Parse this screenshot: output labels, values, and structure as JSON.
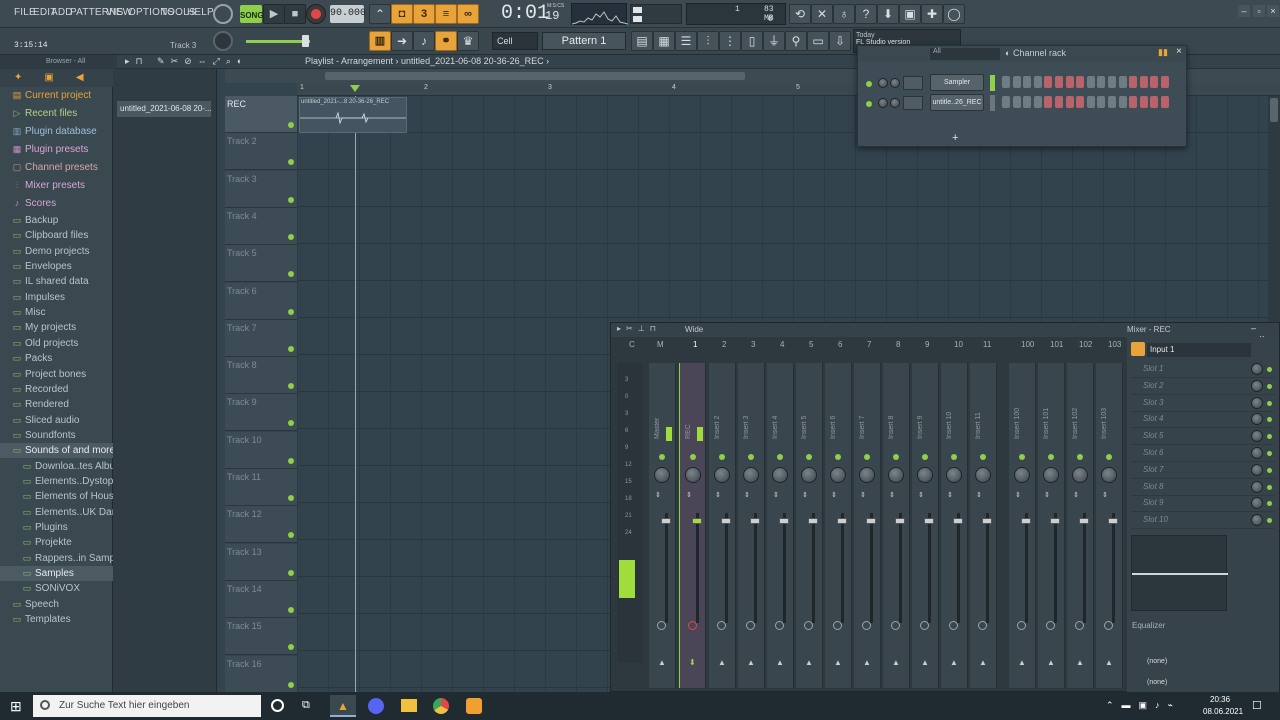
{
  "menu": [
    "FILE",
    "EDIT",
    "ADD",
    "PATTERNS",
    "VIEW",
    "OPTIONS",
    "TOOLS",
    "HELP"
  ],
  "transport": {
    "mode": "SONG",
    "tempo": "90.000",
    "time": "0:01",
    "time_ms": "19",
    "time_unit": "M:S:CS"
  },
  "hint": {
    "time": "3:15:14",
    "track": "Track 3"
  },
  "memory": {
    "value": "1",
    "mb": "83 MB",
    "voices": "0"
  },
  "snap": "Cell",
  "pattern": "Pattern 1",
  "news": {
    "line1": "Today",
    "line2": "FL Studio version"
  },
  "browser": {
    "title": "Browser - All",
    "items": [
      {
        "label": "Current project",
        "icon": "folder-project-icon"
      },
      {
        "label": "Recent files",
        "icon": "folder-recent-icon"
      },
      {
        "label": "Plugin database",
        "icon": "plugin-icon"
      },
      {
        "label": "Plugin presets",
        "icon": "plugin-preset-icon"
      },
      {
        "label": "Channel presets",
        "icon": "channel-preset-icon"
      },
      {
        "label": "Mixer presets",
        "icon": "mixer-preset-icon"
      },
      {
        "label": "Scores",
        "icon": "note-icon"
      },
      {
        "label": "Backup",
        "icon": "folder-icon"
      },
      {
        "label": "Clipboard files",
        "icon": "folder-icon"
      },
      {
        "label": "Demo projects",
        "icon": "folder-icon"
      },
      {
        "label": "Envelopes",
        "icon": "folder-icon"
      },
      {
        "label": "IL shared data",
        "icon": "folder-icon"
      },
      {
        "label": "Impulses",
        "icon": "folder-icon"
      },
      {
        "label": "Misc",
        "icon": "folder-icon"
      },
      {
        "label": "My projects",
        "icon": "folder-icon"
      },
      {
        "label": "Old projects",
        "icon": "folder-icon"
      },
      {
        "label": "Packs",
        "icon": "folder-icon"
      },
      {
        "label": "Project bones",
        "icon": "folder-icon"
      },
      {
        "label": "Recorded",
        "icon": "folder-icon"
      },
      {
        "label": "Rendered",
        "icon": "folder-icon"
      },
      {
        "label": "Sliced audio",
        "icon": "folder-icon"
      },
      {
        "label": "Soundfonts",
        "icon": "folder-icon"
      },
      {
        "label": "Sounds of and more",
        "icon": "folder-open-icon",
        "selected": true
      },
      {
        "label": "Downloa..tes Album",
        "icon": "folder-icon",
        "sub": true
      },
      {
        "label": "Elements..Dystopia",
        "icon": "folder-icon",
        "sub": true
      },
      {
        "label": "Elements of House",
        "icon": "folder-icon",
        "sub": true
      },
      {
        "label": "Elements..UK Dance",
        "icon": "folder-icon",
        "sub": true
      },
      {
        "label": "Plugins",
        "icon": "folder-icon",
        "sub": true
      },
      {
        "label": "Projekte",
        "icon": "folder-icon",
        "sub": true
      },
      {
        "label": "Rappers..in Samples",
        "icon": "folder-icon",
        "sub": true
      },
      {
        "label": "Samples",
        "icon": "folder-icon",
        "sub": true,
        "selected": true
      },
      {
        "label": "SONiVOX",
        "icon": "folder-icon",
        "sub": true
      },
      {
        "label": "Speech",
        "icon": "folder-icon"
      },
      {
        "label": "Templates",
        "icon": "folder-icon"
      }
    ]
  },
  "picker": {
    "item": "untitled_2021-06-08 20-..."
  },
  "playlist": {
    "breadcrumb": "Playlist - Arrangement",
    "project": "untitled_2021-06-08 20-36-26_REC",
    "clip_label": "untitled_2021-...8 20-36-26_REC",
    "bars": [
      "1",
      "2",
      "3",
      "4",
      "5"
    ],
    "tracks": [
      "REC",
      "Track 2",
      "Track 3",
      "Track 4",
      "Track 5",
      "Track 6",
      "Track 7",
      "Track 8",
      "Track 9",
      "Track 10",
      "Track 11",
      "Track 12",
      "Track 13",
      "Track 14",
      "Track 15",
      "Track 16"
    ]
  },
  "rack": {
    "title": "Channel rack",
    "filter": "All",
    "channels": [
      "Sampler",
      "untitle..26_REC"
    ],
    "add": "+"
  },
  "mixer": {
    "title": "Mixer - REC",
    "preset": "Wide",
    "header": [
      "C",
      "M",
      "1",
      "2",
      "3",
      "4",
      "5",
      "6",
      "7",
      "8",
      "9",
      "10",
      "11",
      "100",
      "101",
      "102",
      "103"
    ],
    "strip_names": [
      "Master",
      "REC",
      "Insert 2",
      "Insert 3",
      "Insert 4",
      "Insert 5",
      "Insert 6",
      "Insert 7",
      "Insert 8",
      "Insert 9",
      "Insert 10",
      "Insert 11",
      "Insert 100",
      "Insert 101",
      "Insert 102",
      "Insert 103"
    ],
    "scale": [
      "3",
      "0",
      "3",
      "6",
      "9",
      "12",
      "15",
      "18",
      "21",
      "24"
    ],
    "input": "Input 1",
    "slots": [
      "Slot 1",
      "Slot 2",
      "Slot 3",
      "Slot 4",
      "Slot 5",
      "Slot 6",
      "Slot 7",
      "Slot 8",
      "Slot 9",
      "Slot 10"
    ],
    "eq_label": "Equalizer",
    "send1": "(none)",
    "send2": "(none)"
  },
  "taskbar": {
    "search": "Zur Suche Text hier eingeben",
    "time": "20:36",
    "date": "08.06.2021"
  },
  "colors": {
    "accent": "#e8a33a",
    "green": "#8fcf4a",
    "record": "#e04848",
    "bg": "#34444e"
  }
}
